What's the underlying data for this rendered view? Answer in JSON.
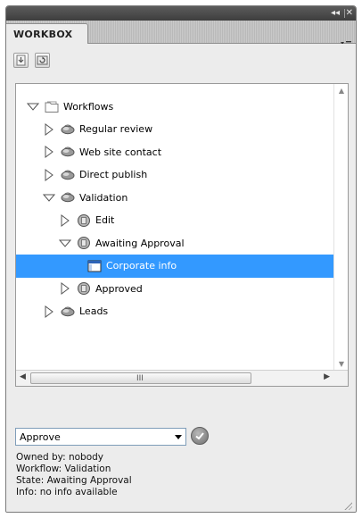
{
  "panel": {
    "tab_title": "WORKBOX",
    "window_controls": {
      "collapse": "◂◂",
      "close": "✕"
    }
  },
  "toolbar": {
    "buttons": [
      {
        "icon": "download-icon"
      },
      {
        "icon": "refresh-icon"
      }
    ]
  },
  "tree": {
    "items": [
      {
        "label": "Workflows",
        "level": 0,
        "expanded": true,
        "icon": "folder-icon"
      },
      {
        "label": "Regular review",
        "level": 1,
        "expanded": false,
        "icon": "workflow-icon"
      },
      {
        "label": "Web site contact",
        "level": 1,
        "expanded": false,
        "icon": "workflow-icon"
      },
      {
        "label": "Direct publish",
        "level": 1,
        "expanded": false,
        "icon": "workflow-icon"
      },
      {
        "label": "Validation",
        "level": 1,
        "expanded": true,
        "icon": "workflow-icon"
      },
      {
        "label": "Edit",
        "level": 2,
        "expanded": false,
        "icon": "state-icon"
      },
      {
        "label": "Awaiting Approval",
        "level": 2,
        "expanded": true,
        "icon": "state-icon"
      },
      {
        "label": "Corporate info",
        "level": 3,
        "selected": true,
        "icon": "document-icon"
      },
      {
        "label": "Approved",
        "level": 2,
        "expanded": false,
        "icon": "state-icon"
      },
      {
        "label": "Leads",
        "level": 1,
        "expanded": false,
        "icon": "workflow-icon"
      }
    ]
  },
  "scroll": {
    "grip": "III"
  },
  "action": {
    "selected": "Approve"
  },
  "info": {
    "owned_by": "Owned by: nobody",
    "workflow": "Workflow: Validation",
    "state": "State: Awaiting Approval",
    "info": "Info: no info available"
  }
}
